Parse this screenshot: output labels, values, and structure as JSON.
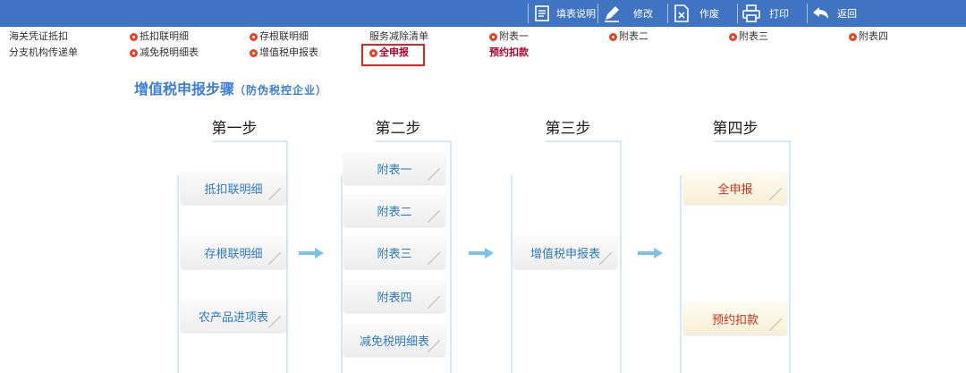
{
  "toolbar": {
    "items": [
      {
        "label": "填表说明",
        "icon": "document-list-icon"
      },
      {
        "label": "修改",
        "icon": "pencil-icon"
      },
      {
        "label": "作废",
        "icon": "void-document-icon"
      },
      {
        "label": "打印",
        "icon": "printer-icon"
      },
      {
        "label": "返回",
        "icon": "back-arrow-icon"
      }
    ],
    "bg": "#3f74c3"
  },
  "menu": {
    "row1": [
      {
        "label": "海关凭证抵扣",
        "dot": false
      },
      {
        "label": "抵扣联明细",
        "dot": true
      },
      {
        "label": "存根联明细",
        "dot": true
      },
      {
        "label": "服务减除清单",
        "dot": false
      },
      {
        "label": "附表一",
        "dot": true
      },
      {
        "label": "附表二",
        "dot": true
      },
      {
        "label": "附表三",
        "dot": true
      },
      {
        "label": "附表四",
        "dot": true
      }
    ],
    "row2": [
      {
        "label": "分支机构传递单",
        "dot": false
      },
      {
        "label": "减免税明细表",
        "dot": true
      },
      {
        "label": "增值税申报表",
        "dot": true
      },
      {
        "label": "全申报",
        "dot": true,
        "highlight": true
      },
      {
        "label": "预约扣款",
        "dot": false,
        "bold": true
      }
    ]
  },
  "page": {
    "title": "增值税申报步骤",
    "subtitle": "（防伪税控企业）"
  },
  "steps": [
    {
      "title": "第一步",
      "cards": [
        "抵扣联明细",
        "存根联明细",
        "农产品进项表"
      ]
    },
    {
      "title": "第二步",
      "cards": [
        "附表一",
        "附表二",
        "附表三",
        "附表四",
        "减免税明细表"
      ]
    },
    {
      "title": "第三步",
      "cards": [
        "增值税申报表"
      ]
    },
    {
      "title": "第四步",
      "cards": [
        "全申报",
        "预约扣款"
      ]
    }
  ],
  "colors": {
    "accent": "#3b7fd9",
    "card_text": "#2b7ac9",
    "highlight_border": "#e5231b",
    "red_text": "#d42d1c"
  }
}
